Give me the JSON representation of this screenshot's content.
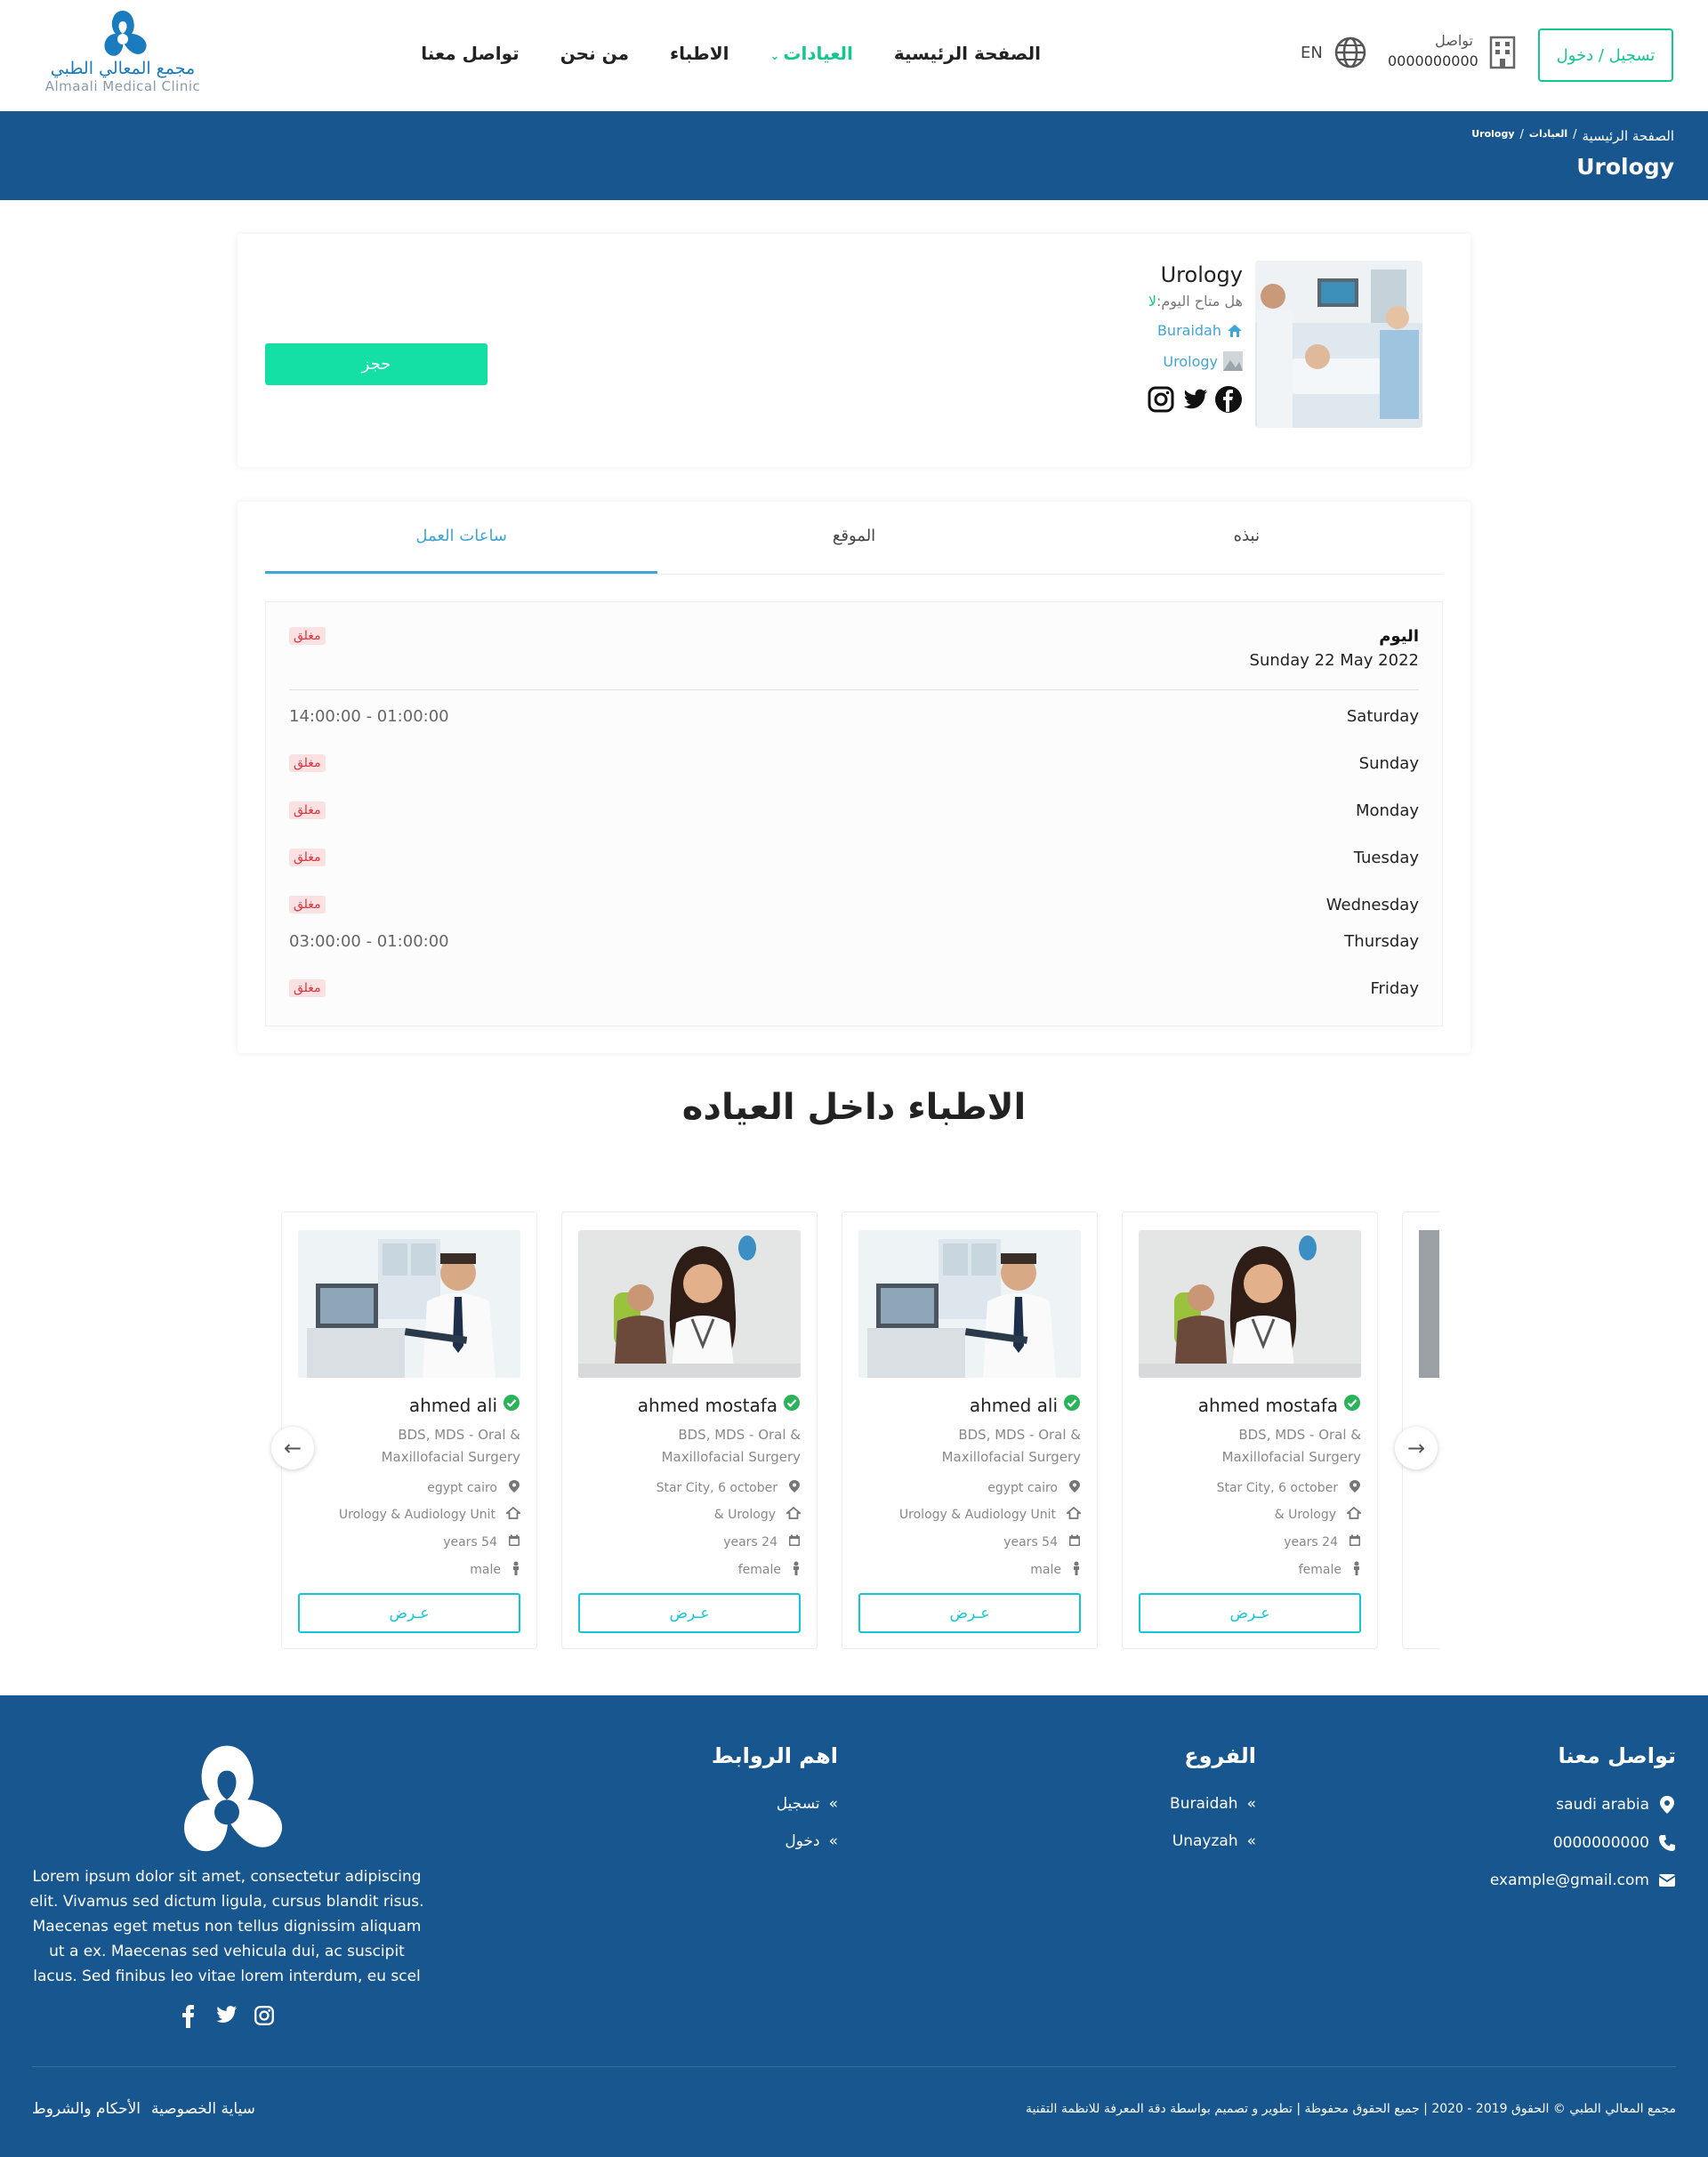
{
  "header": {
    "logo_ar": "مجمع المعالي الطبي",
    "logo_en": "Almaali Medical Clinic",
    "nav": [
      "الصفحة الرئيسية",
      "العيادات",
      "الاطباء",
      "من نحن",
      "تواصل معنا"
    ],
    "lang": "EN",
    "contact_label": "تواصل",
    "contact_phone": "0000000000",
    "login": "تسجيل / دخول"
  },
  "band": {
    "crumb_home": "الصفحة الرئيسية",
    "crumb_clinics": "العيادات",
    "crumb_current": "Urology",
    "title": "Urology"
  },
  "clinic": {
    "title": "Urology",
    "open_today_label": "هل متاح اليوم:",
    "open_today_value": "لا",
    "branch": "Buraidah",
    "category": "Urology",
    "book": "حجز"
  },
  "tabs": [
    "نبذه",
    "الموقع",
    "ساعات العمل"
  ],
  "hours": {
    "today_label": "اليوم",
    "today_date": "Sunday 22 May 2022",
    "closed": "مغلق",
    "days": [
      {
        "day": "Saturday",
        "time": "14:00:00 - 01:00:00"
      },
      {
        "day": "Sunday",
        "time": ""
      },
      {
        "day": "Monday",
        "time": ""
      },
      {
        "day": "Tuesday",
        "time": ""
      },
      {
        "day": "Wednesday",
        "time": ""
      },
      {
        "day": "Thursday",
        "time": "03:00:00 - 01:00:00"
      },
      {
        "day": "Friday",
        "time": ""
      }
    ]
  },
  "doctors_title": "الاطباء داخل العياده",
  "doctors": [
    {
      "name": "ahmed ali",
      "spec": "BDS, MDS - Oral & Maxillofacial Surgery",
      "location": "egypt cairo",
      "unit": "Urology & Audiology Unit",
      "years": "54 years",
      "gender": "male",
      "view": "عـرض",
      "photo": "male"
    },
    {
      "name": "ahmed mostafa",
      "spec": "BDS, MDS - Oral & Maxillofacial Surgery",
      "location": "Star City, 6 october",
      "unit": "Urology &",
      "years": "24 years",
      "gender": "female",
      "view": "عـرض",
      "photo": "female"
    },
    {
      "name": "ahmed ali",
      "spec": "BDS, MDS - Oral & Maxillofacial Surgery",
      "location": "egypt cairo",
      "unit": "Urology & Audiology Unit",
      "years": "54 years",
      "gender": "male",
      "view": "عـرض",
      "photo": "male"
    },
    {
      "name": "ahmed mostafa",
      "spec": "BDS, MDS - Oral & Maxillofacial Surgery",
      "location": "Star City, 6 october",
      "unit": "Urology &",
      "years": "24 years",
      "gender": "female",
      "view": "عـرض",
      "photo": "female"
    }
  ],
  "footer": {
    "contact_head": "تواصل معنا",
    "address": "saudi arabia",
    "phone": "0000000000",
    "email": "example@gmail.com",
    "branches_head": "الفروع",
    "branches": [
      "Buraidah",
      "Unayzah"
    ],
    "links_head": "اهم الروابط",
    "links": [
      "تسجيل",
      "دخول"
    ],
    "about": "Lorem ipsum dolor sit amet, consectetur adipiscing elit. Vivamus sed dictum ligula, cursus blandit risus. Maecenas eget metus non tellus dignissim aliquam ut a ex. Maecenas sed vehicula dui, ac suscipit lacus. Sed finibus leo vitae lorem interdum, eu scel",
    "copyright": "مجمع المعالي الطبي © الحقوق 2019 - 2020 | جميع الحقوق محفوظة | تطوير و تصميم بواسطة دقة المعرفة للانظمة التقنية",
    "terms": "الأحكام والشروط",
    "privacy": "سياية الخصوصية"
  },
  "colors": {
    "brand_blue": "#17568f",
    "accent_green": "#14c78d",
    "link_blue": "#3fa5d8",
    "closed_red": "#d9363e"
  }
}
